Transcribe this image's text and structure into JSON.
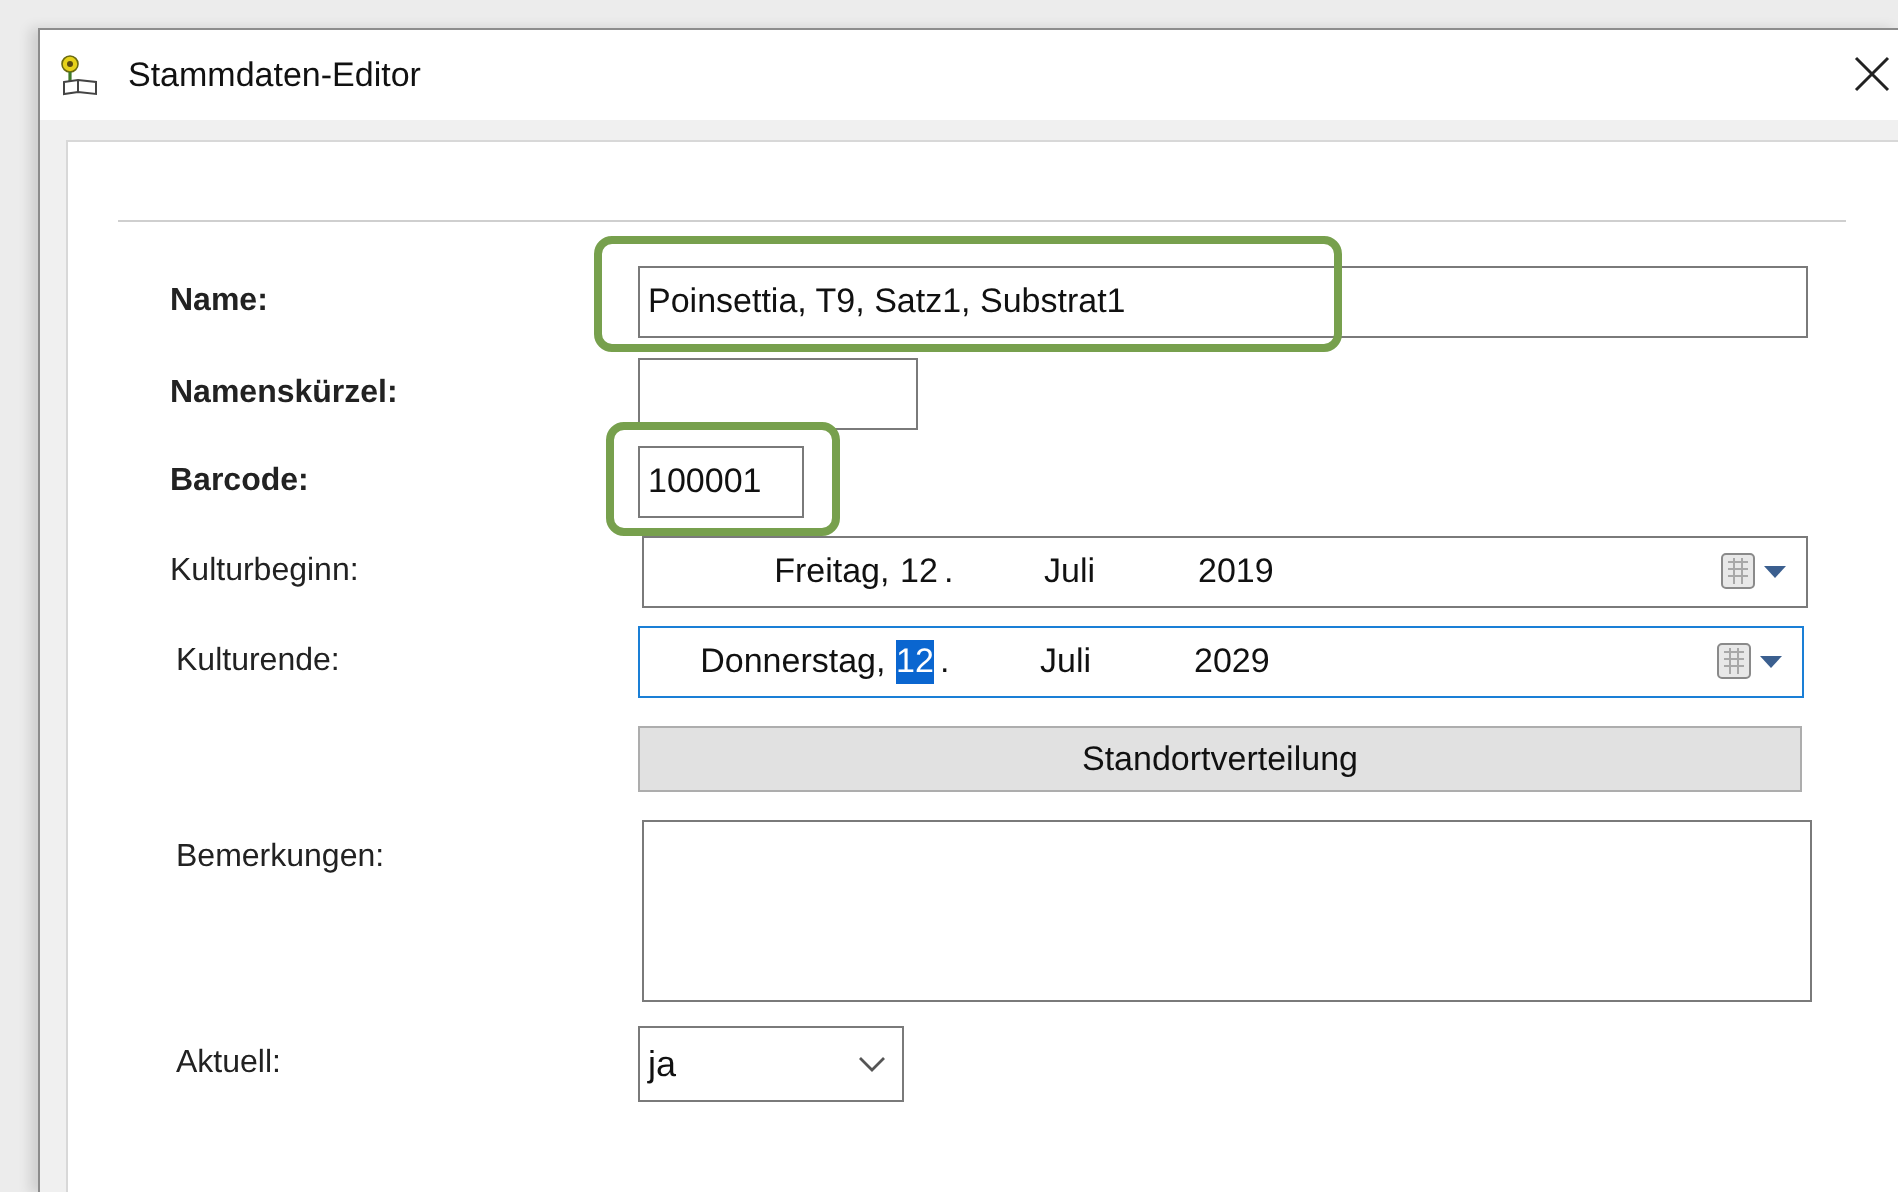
{
  "window": {
    "title": "Stammdaten-Editor"
  },
  "fields": [
    {
      "kind": "text",
      "label": "Name:",
      "required": true,
      "value": "Poinsettia, T9, Satz1, Substrat1",
      "highlighted": true
    },
    {
      "kind": "text",
      "label": "Namenskürzel:",
      "required": true,
      "highlighted": false
    },
    {
      "kind": "text",
      "label": "Barcode:",
      "required": true,
      "value": "100001",
      "highlighted": true
    },
    {
      "kind": "date",
      "label": "Kulturbeginn:",
      "required": false,
      "focused": false,
      "parts": [
        {
          "text": "Freitag",
          "selected": false
        },
        {
          "text": ",",
          "selected": false
        },
        {
          "text": "12",
          "selected": false
        },
        {
          "text": ".",
          "selected": false
        },
        {
          "text": "Juli",
          "selected": false
        },
        {
          "text": "2019",
          "selected": false
        }
      ]
    },
    {
      "kind": "date",
      "label": "Kulturende:",
      "required": false,
      "focused": true,
      "parts": [
        {
          "text": "Donnerstag",
          "selected": false
        },
        {
          "text": ",",
          "selected": false
        },
        {
          "text": "12",
          "selected": true
        },
        {
          "text": ".",
          "selected": false
        },
        {
          "text": "Juli",
          "selected": false
        },
        {
          "text": "2029",
          "selected": false
        }
      ]
    },
    {
      "kind": "button",
      "label": "Standortverteilung"
    },
    {
      "kind": "textarea",
      "label": "Bemerkungen:",
      "required": false
    },
    {
      "kind": "select",
      "label": "Aktuell:",
      "required": false,
      "value": "ja"
    }
  ]
}
